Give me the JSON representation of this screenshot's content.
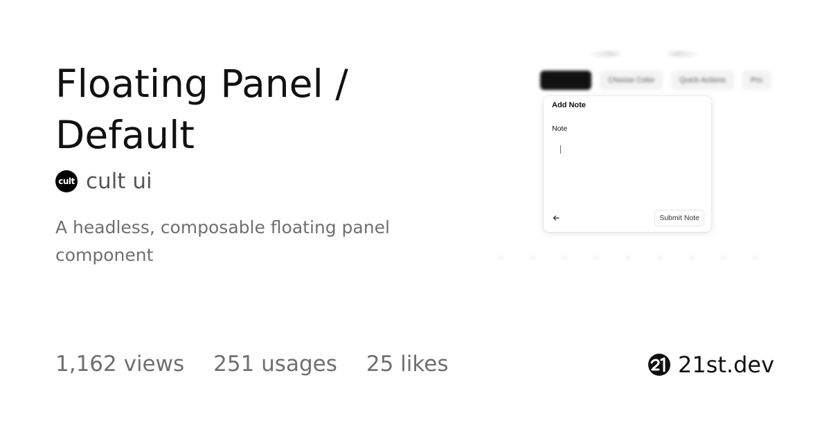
{
  "component": {
    "title": "Floating Panel / Default",
    "description": "A headless, composable floating panel component"
  },
  "author": {
    "logo_text": "cult",
    "name": "cult ui"
  },
  "stats": {
    "views": "1,162 views",
    "usages": "251 usages",
    "likes": "25 likes"
  },
  "brand": {
    "logo_icon": "21st-dev-logo-icon",
    "name": "21st.dev"
  },
  "preview": {
    "toolbar_buttons": [
      "",
      "Choose Color",
      "Quick Actions",
      "Pro"
    ],
    "panel": {
      "title": "Add Note",
      "field_label": "Note",
      "textarea_value": "",
      "back_icon": "arrow-left-icon",
      "submit_label": "Submit Note"
    }
  },
  "colors": {
    "text_primary": "#111111",
    "text_secondary": "#6f6f6f",
    "background": "#ffffff"
  }
}
